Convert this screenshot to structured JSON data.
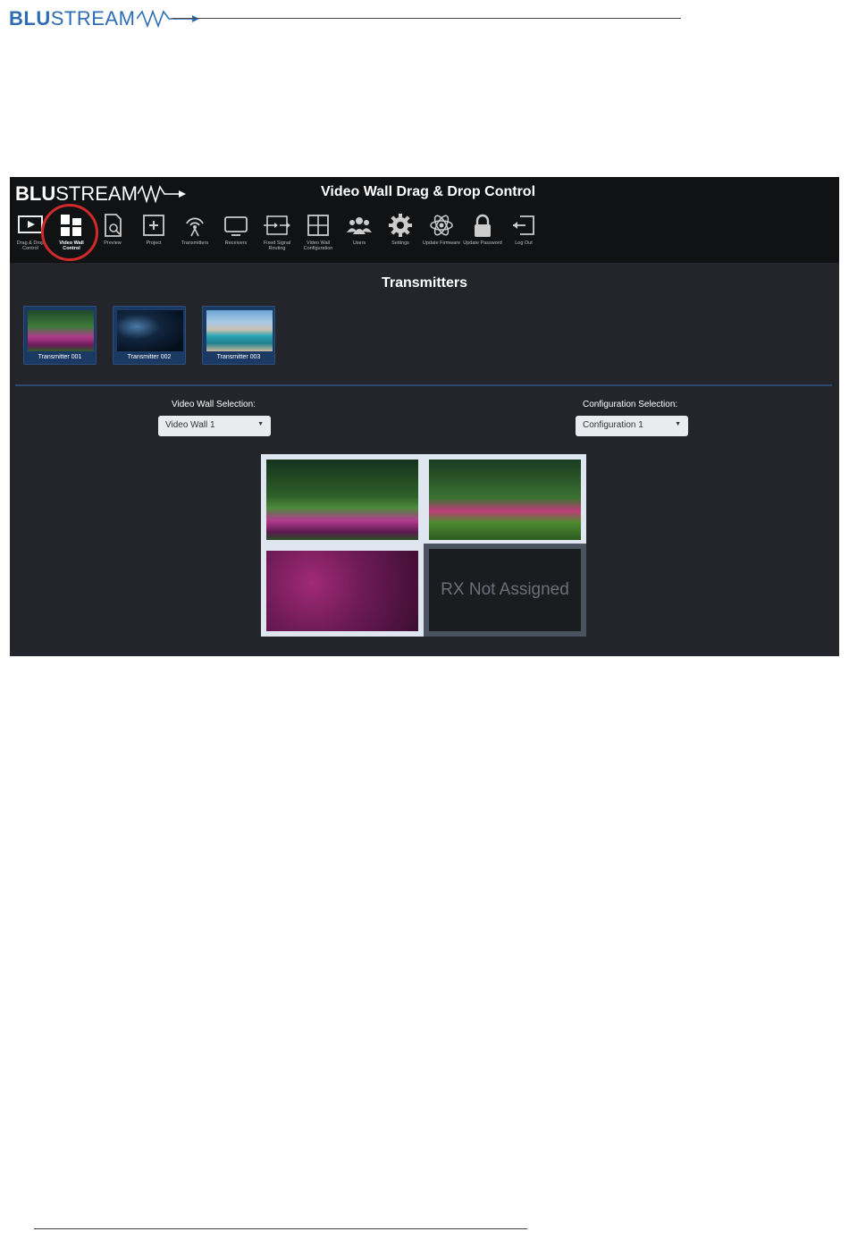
{
  "doc": {
    "brand_bold": "BLU",
    "brand_rest": "STREAM"
  },
  "app": {
    "brand_bold": "BLU",
    "brand_rest": "STREAM",
    "title": "Video Wall Drag & Drop Control",
    "nav": [
      {
        "label": "Drag & Drop Control",
        "icon": "play-screen-icon"
      },
      {
        "label": "Video Wall Control",
        "icon": "video-wall-grid-icon",
        "active": true
      },
      {
        "label": "Preview",
        "icon": "preview-doc-icon"
      },
      {
        "label": "Project",
        "icon": "plus-box-icon"
      },
      {
        "label": "Transmitters",
        "icon": "antenna-icon"
      },
      {
        "label": "Receivers",
        "icon": "monitor-icon"
      },
      {
        "label": "Fixed Signal Routing",
        "icon": "routing-icon"
      },
      {
        "label": "Video Wall Configuration",
        "icon": "grid-icon"
      },
      {
        "label": "Users",
        "icon": "users-icon"
      },
      {
        "label": "Settings",
        "icon": "gear-icon"
      },
      {
        "label": "Update Firmware",
        "icon": "atom-icon"
      },
      {
        "label": "Update Password",
        "icon": "lock-icon"
      },
      {
        "label": "Log Out",
        "icon": "logout-icon"
      }
    ],
    "section_title": "Transmitters",
    "transmitters": [
      {
        "label": "Transmitter 001"
      },
      {
        "label": "Transmitter 002"
      },
      {
        "label": "Transmitter 003"
      }
    ],
    "video_wall_selection": {
      "label": "Video Wall Selection:",
      "value": "Video Wall 1"
    },
    "configuration_selection": {
      "label": "Configuration Selection:",
      "value": "Configuration 1"
    },
    "wall": {
      "unassigned_text": "RX Not Assigned"
    },
    "colors": {
      "accent": "#2d6db5",
      "highlight_ring": "#d22a2a",
      "background": "#23252b"
    }
  }
}
